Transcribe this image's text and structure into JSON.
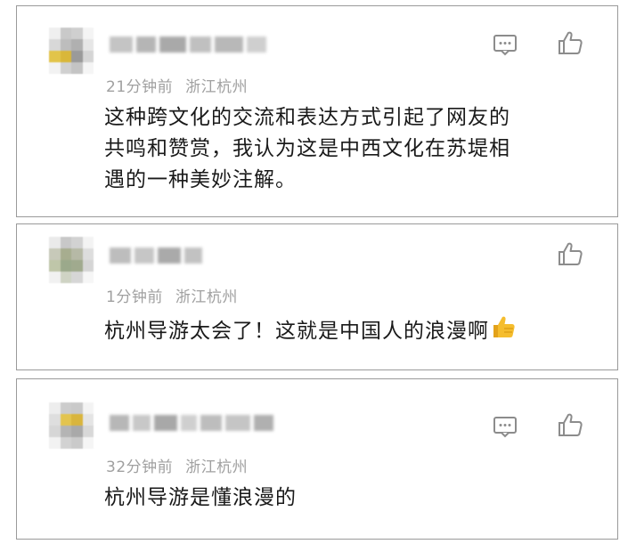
{
  "comments": [
    {
      "meta_time": "21分钟前",
      "meta_location": "浙江杭州",
      "text": "这种跨文化的交流和表达方式引起了网友的\n共鸣和赞赏，我认为这是中西文化在苏堤相\n遇的一种美妙注解。",
      "has_reply_icon": true,
      "avatar_icon": "pixelated-avatar",
      "username": "blurred"
    },
    {
      "meta_time": "1分钟前",
      "meta_location": "浙江杭州",
      "text": "杭州导游太会了！这就是中国人的浪漫啊",
      "emoji": "thumbs-up-emoji",
      "has_reply_icon": false,
      "avatar_icon": "pixelated-avatar",
      "username": "blurred"
    },
    {
      "meta_time": "32分钟前",
      "meta_location": "浙江杭州",
      "text": "杭州导游是懂浪漫的",
      "has_reply_icon": true,
      "avatar_icon": "pixelated-avatar",
      "username": "blurred"
    }
  ],
  "icons": {
    "reply": "comment-bubble-icon",
    "like": "thumbs-up-outline-icon"
  },
  "colors": {
    "border": "#9a9a9a",
    "meta": "#a0a0a0",
    "text": "#1a1a1a",
    "icon": "#8c8c8c"
  }
}
